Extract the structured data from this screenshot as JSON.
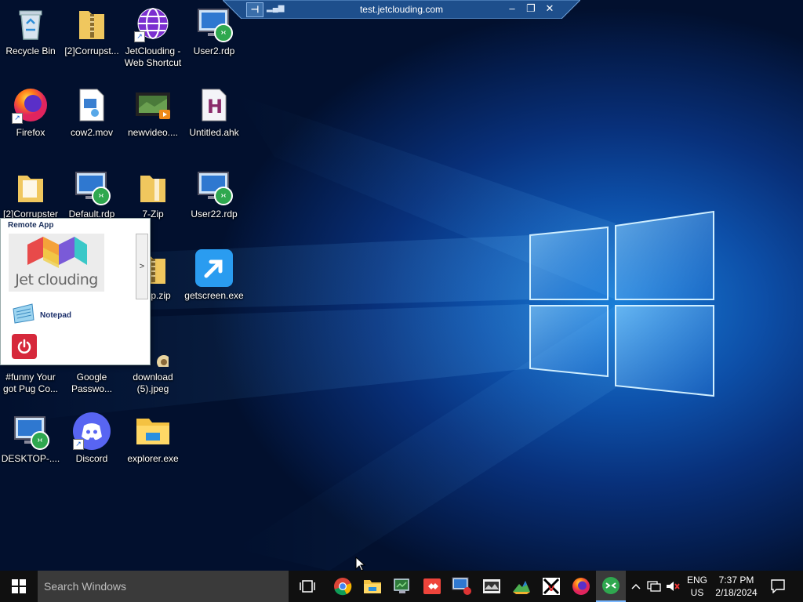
{
  "remote_bar": {
    "title": "test.jetclouding.com",
    "pin_icon": "pin-icon",
    "signal_icon": "signal-icon",
    "minimize": "–",
    "restore": "❐",
    "close": "✕"
  },
  "desktop_icons": [
    {
      "label": "Recycle Bin",
      "icon": "recycle-bin-icon"
    },
    {
      "label": "[2]Corrupst...",
      "icon": "zip-folder-icon"
    },
    {
      "label": "JetClouding - Web Shortcut",
      "icon": "web-globe-icon"
    },
    {
      "label": "User2.rdp",
      "icon": "rdp-icon"
    },
    {
      "label": "Firefox",
      "icon": "firefox-icon"
    },
    {
      "label": "cow2.mov",
      "icon": "video-file-icon"
    },
    {
      "label": "newvideo....",
      "icon": "video-thumbnail-icon"
    },
    {
      "label": "Untitled.ahk",
      "icon": "ahk-script-icon"
    },
    {
      "label": "[2]Corrupster",
      "icon": "folder-icon"
    },
    {
      "label": "Default.rdp",
      "icon": "rdp-icon"
    },
    {
      "label": "7-Zip",
      "icon": "folder-icon"
    },
    {
      "label": "User22.rdp",
      "icon": "rdp-icon"
    },
    {
      "label": "p.zip",
      "icon": "zip-folder-icon"
    },
    {
      "label": "getscreen.exe",
      "icon": "getscreen-icon"
    },
    {
      "label": "#funny Your got Pug Co...",
      "icon": "image-file-icon"
    },
    {
      "label": "Google Passwo...",
      "icon": "google-passwords-icon"
    },
    {
      "label": "download (5).jpeg",
      "icon": "jpeg-file-icon"
    },
    {
      "label": "DESKTOP-....",
      "icon": "rdp-icon"
    },
    {
      "label": "Discord",
      "icon": "discord-icon"
    },
    {
      "label": "explorer.exe",
      "icon": "explorer-folder-icon"
    }
  ],
  "remote_app_panel": {
    "title": "Remote App",
    "logo_text": "Jet clouding",
    "scroll_arrow": ">",
    "apps": [
      {
        "label": "Notepad",
        "icon": "notepad-icon"
      }
    ],
    "power_icon": "power-icon"
  },
  "taskbar": {
    "search_placeholder": "Search Windows",
    "pinned": [
      "task-view-icon",
      "chrome-icon",
      "file-explorer-icon",
      "remote-desktop-manager-icon",
      "anydesk-icon",
      "rdp-connection-icon",
      "video-editor-icon",
      "terrain-app-icon",
      "vcxsrv-icon",
      "firefox-icon",
      "jetclouding-rdp-icon"
    ],
    "tray": {
      "lang": "ENG",
      "region": "US",
      "time": "7:37 PM",
      "date": "2/18/2024"
    }
  },
  "colors": {
    "taskbar": "#101010",
    "search": "#3a3a3a",
    "accent": "#1a7fd8",
    "power": "#d6283b"
  }
}
